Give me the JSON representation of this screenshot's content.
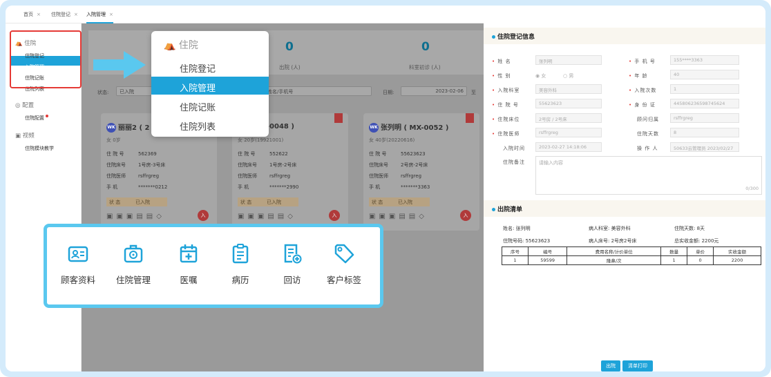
{
  "tabs": [
    {
      "label": "首页"
    },
    {
      "label": "住院登记"
    },
    {
      "label": "入院管理"
    }
  ],
  "tab_close": "×",
  "sidebar": {
    "inpatient": {
      "title": "住院",
      "items": [
        "住院登记",
        "入院管理",
        "住院记账",
        "住院列表"
      ]
    },
    "config": {
      "title": "配置",
      "items": [
        "住院配置"
      ]
    },
    "video": {
      "title": "视频",
      "items": [
        "住院模块教学"
      ]
    }
  },
  "stats": [
    {
      "value": "0",
      "label": "出院 (人)"
    },
    {
      "value": "0",
      "label": "科室初诊 (人)"
    }
  ],
  "filters": {
    "status_label": "状态:",
    "status_value": "已入院",
    "search_placeholder": "姓名/手机号",
    "date_label": "日期:",
    "date_value": "2023-02-06",
    "date_to": "至"
  },
  "cards": [
    {
      "name": "丽丽2 ( 2",
      "sub": "女 0岁",
      "no": "562369",
      "bed": "1号房-3号床",
      "doctor": "rsffrgreg",
      "phone": "*******0212",
      "state": "已入院"
    },
    {
      "name": "( MX-0048 )",
      "sub": "女 20岁(19921001)",
      "no": "552622",
      "bed": "1号房-2号床",
      "doctor": "rsffrgreg",
      "phone": "*******2990",
      "state": "已入院"
    },
    {
      "name": "张列明 ( MX-0052 )",
      "sub": "女 40岁(20220616)",
      "no": "55623623",
      "bed": "2号房-2号床",
      "doctor": "rsffrgreg",
      "phone": "*******3363",
      "state": "已入院"
    }
  ],
  "card_labels": {
    "no": "住 院 号",
    "bed": "住院床号",
    "doctor": "住院医师",
    "phone": "手    机",
    "state": "状    态",
    "avatar": "WK",
    "in": "入"
  },
  "popup": {
    "title": "住院",
    "items": [
      "住院登记",
      "入院管理",
      "住院记账",
      "住院列表"
    ]
  },
  "features": [
    "顾客资料",
    "住院管理",
    "医嘱",
    "病历",
    "回访",
    "客户标签"
  ],
  "reg": {
    "title": "住院登记信息",
    "fields": {
      "name": {
        "label": "姓    名",
        "value": "张列明"
      },
      "phone": {
        "label": "手 机 号",
        "value": "155****3363"
      },
      "gender": {
        "label": "性    别",
        "f": "女",
        "m": "男"
      },
      "age": {
        "label": "年    龄",
        "value": "40"
      },
      "dept": {
        "label": "入院科室",
        "value": "美容外科"
      },
      "times": {
        "label": "入院次数",
        "value": "1"
      },
      "no": {
        "label": "住 院 号",
        "value": "55623623"
      },
      "id": {
        "label": "身 份 证",
        "value": "445806236598745624"
      },
      "bed": {
        "label": "住院床位",
        "value": "2号房 / 2号床"
      },
      "owner": {
        "label": "顾问归属",
        "value": "rsffrgreg"
      },
      "doctor": {
        "label": "住院医师",
        "value": "rsffrgreg"
      },
      "days": {
        "label": "住院天数",
        "value": "8"
      },
      "time": {
        "label": "入院时间",
        "value": "2023-02-27 14:18:06"
      },
      "operator": {
        "label": "操 作 人",
        "value": "50633云管理员 2023/02/27"
      },
      "remark": {
        "label": "住院备注",
        "placeholder": "请输入内容",
        "count": "0/300"
      }
    }
  },
  "bill": {
    "title": "出院清单",
    "info": [
      "姓名: 张列明",
      "病人科室: 美容外科",
      "住院天数: 8天",
      "住院号码: 55623623",
      "病人床号: 2号房2号床",
      "总实收金额: 2200元"
    ],
    "headers": [
      "序号",
      "编号",
      "费用名称/计价单位",
      "数量",
      "单价",
      "实收金额"
    ],
    "rows": [
      [
        "1",
        "59599",
        "隆鼻/次",
        "1",
        "0",
        "2200"
      ]
    ],
    "buttons": [
      "出院",
      "清单打印"
    ]
  },
  "colors": {
    "accent": "#1ea3d9",
    "highlight": "#e53935",
    "callout_border": "#5ac8ef"
  }
}
